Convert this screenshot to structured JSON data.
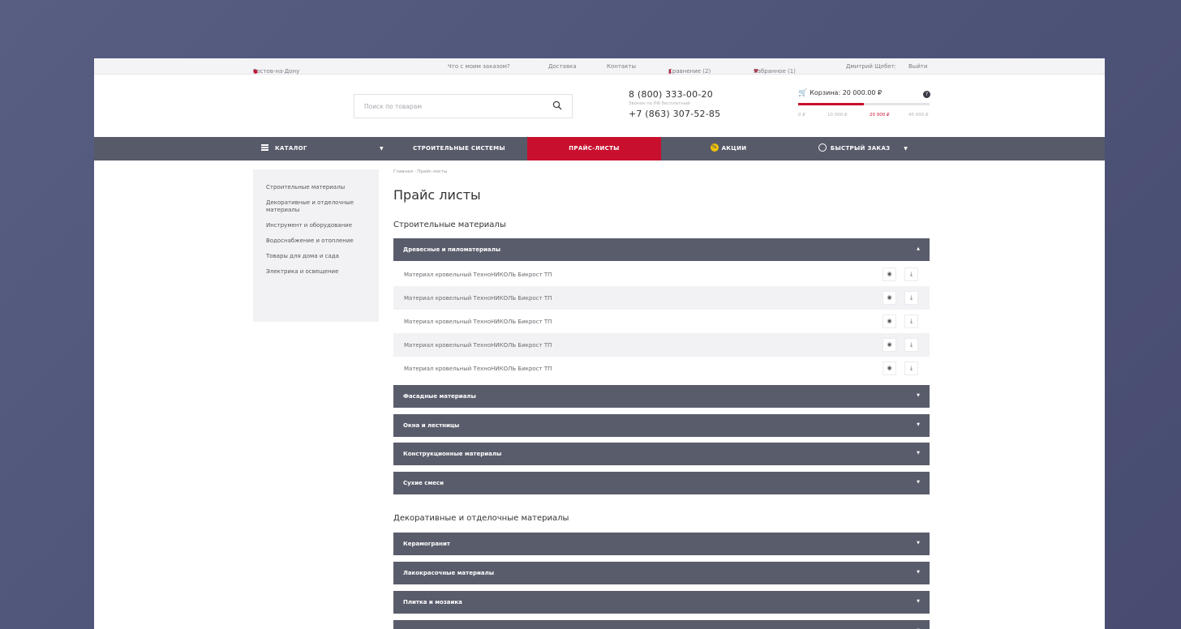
{
  "topbar": {
    "city": "Ростов-на-Дону",
    "order_status": "Что с моим заказом?",
    "delivery": "Доставка",
    "contacts": "Контакты",
    "compare": "Сравнение (2)",
    "favorites": "Избранное (1)",
    "user": "Дмитрий Щебет",
    "separator": "|",
    "logout": "Выйти"
  },
  "search": {
    "placeholder": "Поиск по товарам"
  },
  "phones": {
    "primary": "8 (800) 333-00-20",
    "primary_note": "Звонок по РФ бесплатный",
    "secondary": "+7 (863) 307-52-85"
  },
  "cart": {
    "title": "Корзина: 20 000.00 ₽",
    "info": "?",
    "progress_fraction": 0.5,
    "ticks": [
      "0 ₽",
      "10 000 ₽",
      "20 000 ₽",
      "40 000 ₽"
    ]
  },
  "nav": {
    "catalog": "КАТАЛОГ",
    "systems": "СТРОИТЕЛЬНЫЕ СИСТЕМЫ",
    "prices": "ПРАЙС-ЛИСТЫ",
    "promo": "АКЦИИ",
    "promo_badge": "%",
    "quick": "БЫСТРЫЙ ЗАКАЗ"
  },
  "sidebar": {
    "items": [
      "Строительные материалы",
      "Декоративные и отделочные материалы",
      "Инструмент и оборудование",
      "Водоснабжение и отопление",
      "Товары для дома и сада",
      "Электрика и освещение"
    ]
  },
  "breadcrumb": "Главная - Прайс-листы",
  "page_title": "Прайс листы",
  "sections": [
    {
      "title": "Строительные материалы",
      "groups": [
        {
          "label": "Древесные и пиломатериалы",
          "expanded": true,
          "rows": [
            "Материал кровельный ТехноНИКОЛЬ Бикрост ТП",
            "Материал кровельный ТехноНИКОЛЬ Бикрост ТП",
            "Материал кровельный ТехноНИКОЛЬ Бикрост ТП",
            "Материал кровельный ТехноНИКОЛЬ Бикрост ТП",
            "Материал кровельный ТехноНИКОЛЬ Бикрост ТП"
          ]
        },
        {
          "label": "Фасадные материалы",
          "expanded": false
        },
        {
          "label": "Окна и лестницы",
          "expanded": false
        },
        {
          "label": "Конструкционные материалы",
          "expanded": false
        },
        {
          "label": "Сухие смеси",
          "expanded": false
        }
      ]
    },
    {
      "title": "Декоративные и отделочные материалы",
      "groups": [
        {
          "label": "Керамогранит",
          "expanded": false
        },
        {
          "label": "Лакокрасочные материалы",
          "expanded": false
        },
        {
          "label": "Плитка и мозаика",
          "expanded": false
        },
        {
          "label": "",
          "expanded": false
        }
      ]
    }
  ],
  "icons": {
    "view": "eye-icon",
    "download": "download-icon",
    "collapse": "▲",
    "expand": "▼"
  },
  "colors": {
    "accent": "#c8102e",
    "nav_bg": "#575a69",
    "bar_bg": "#595c6b",
    "background": "#4e5478"
  }
}
